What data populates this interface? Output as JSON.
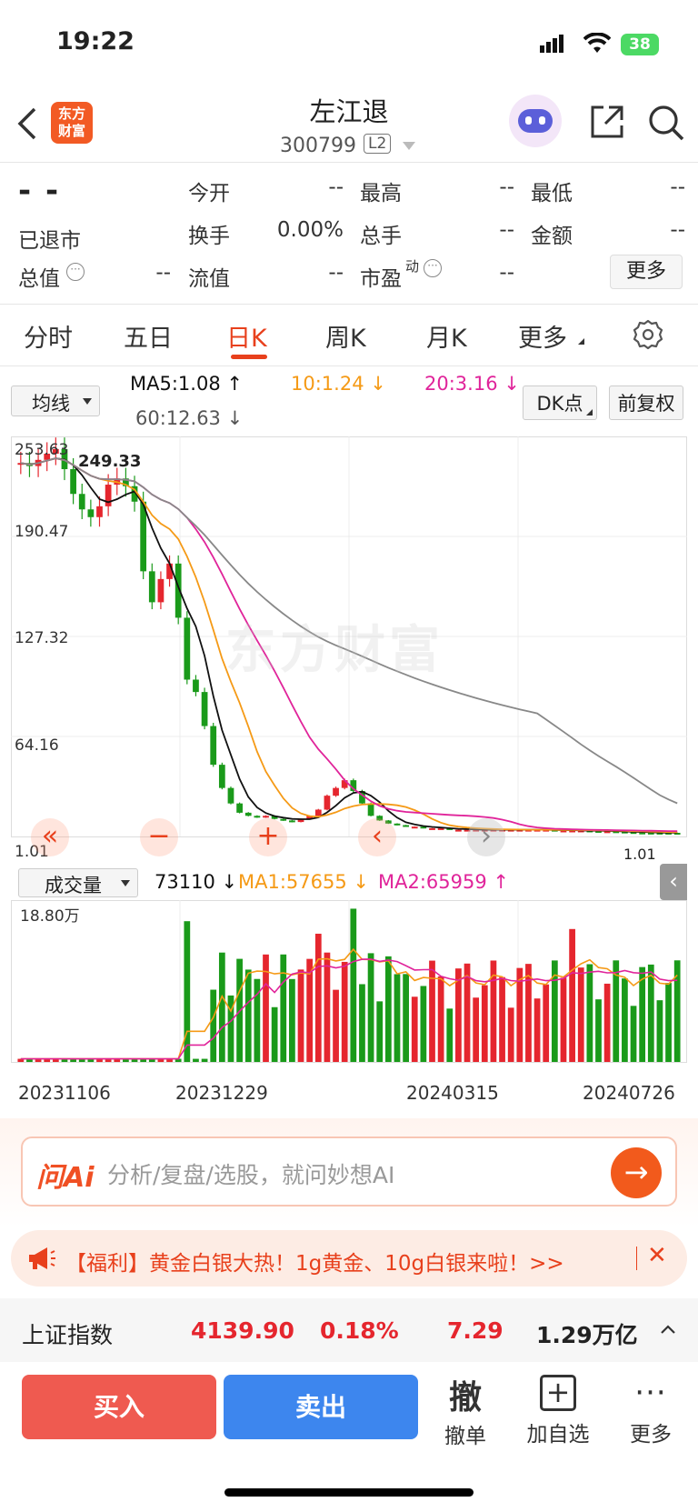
{
  "status_bar": {
    "time": "19:22",
    "battery": "38"
  },
  "header": {
    "title": "左江退",
    "code": "300799",
    "level": "L2",
    "logo_text": "东方财富",
    "icons": [
      "back-arrow-icon",
      "share-icon",
      "search-icon",
      "ai-robot-icon"
    ]
  },
  "quote": {
    "price": "- -",
    "status": "已退市",
    "fields": [
      {
        "label": "今开",
        "value": "--"
      },
      {
        "label": "最高",
        "value": "--"
      },
      {
        "label": "最低",
        "value": "--"
      },
      {
        "label": "换手",
        "value": "0.00%"
      },
      {
        "label": "总手",
        "value": "--"
      },
      {
        "label": "金额",
        "value": "--"
      },
      {
        "label": "总值",
        "value": "--"
      },
      {
        "label": "流值",
        "value": "--"
      },
      {
        "label": "市盈",
        "sup": "动",
        "value": "--"
      }
    ],
    "more": "更多"
  },
  "tabs": [
    "分时",
    "五日",
    "日K",
    "周K",
    "月K",
    "更多"
  ],
  "active_tab": "日K",
  "indicator": {
    "selector": "均线",
    "ma5": "MA5:1.08",
    "ma10": "10:1.24",
    "ma20": "20:3.16",
    "ma60": "60:12.63",
    "dk": "DK点",
    "adjust": "前复权"
  },
  "colors": {
    "up": "#e5262e",
    "down": "#1a9a1a",
    "ma5": "#111111",
    "ma10": "#f59a16",
    "ma20": "#e0249a",
    "ma60": "#888888",
    "accent": "#e8401c"
  },
  "chart_data": {
    "type": "candlestick",
    "y_ticks": [
      "253.63",
      "190.47",
      "127.32",
      "64.16",
      "1.01"
    ],
    "ylim": [
      1.01,
      253.63
    ],
    "annotation_high": "249.33",
    "annotation_low": "1.01",
    "x_labels": [
      "20231106",
      "20231229",
      "20240315",
      "20240726"
    ],
    "watermark": "东方财富",
    "close_approx": [
      240,
      238,
      242,
      246,
      249,
      236,
      220,
      210,
      205,
      212,
      226,
      230,
      225,
      215,
      170,
      150,
      165,
      175,
      140,
      100,
      92,
      70,
      45,
      30,
      20,
      14,
      12,
      11,
      12,
      10,
      9,
      8,
      10,
      12,
      16,
      25,
      30,
      35,
      28,
      20,
      12,
      9,
      7,
      6,
      5,
      5,
      4,
      4,
      4,
      3,
      3,
      3,
      3,
      3,
      3,
      3,
      3,
      3,
      3,
      3,
      3,
      2.5,
      2.5,
      2.5,
      2.5,
      2.2,
      2,
      2,
      1.8,
      1.5,
      1.2,
      1.1,
      1.08,
      1.05,
      1.02,
      1.01
    ],
    "volume_selector": "成交量",
    "volume": "73110",
    "vol_ma1": "MA1:57655",
    "vol_ma2": "MA2:65959",
    "volume_ylabel": "18.80万"
  },
  "chart_controls": [
    "«",
    "−",
    "+",
    "‹",
    "›"
  ],
  "ai": {
    "logo": "问Ai",
    "placeholder": "分析/复盘/选股，就问妙想AI"
  },
  "promo": {
    "text": "【福利】黄金白银大热！1g黄金、10g白银来啦！>>"
  },
  "index_bar": {
    "name": "上证指数",
    "price": "4139.90",
    "pct": "0.18%",
    "change": "7.29",
    "amount": "1.29万亿"
  },
  "bottom_bar": {
    "buy": "买入",
    "sell": "卖出",
    "cancel_big": "撤",
    "cancel": "撤单",
    "add": "加自选",
    "more": "更多"
  }
}
